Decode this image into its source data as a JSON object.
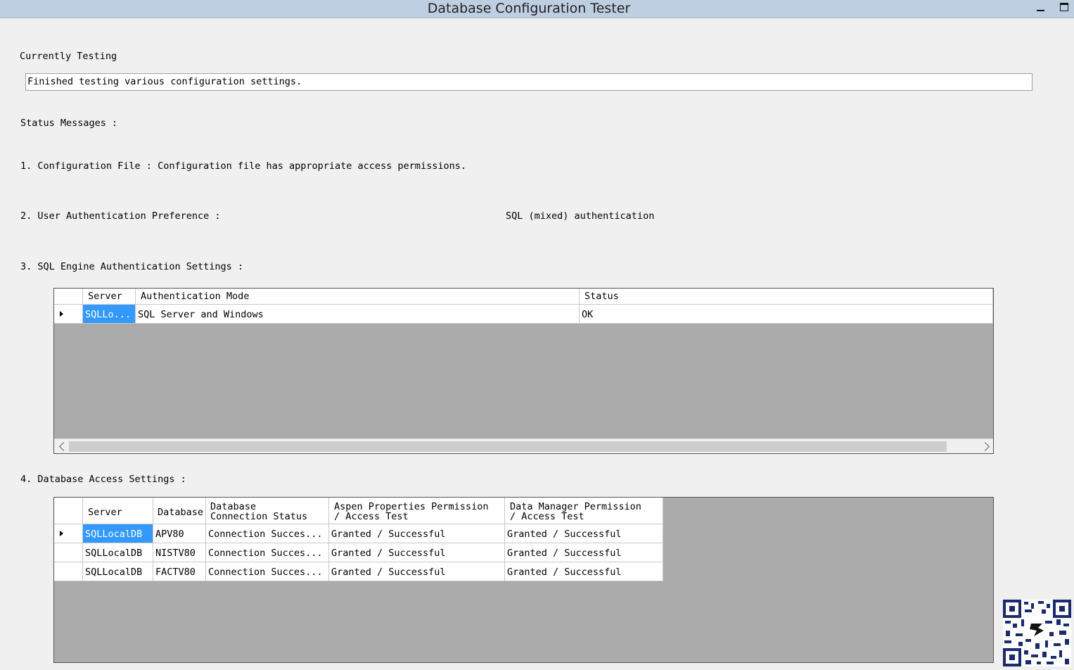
{
  "window": {
    "title": "Database Configuration Tester",
    "minimize_icon": "minimize-icon",
    "maximize_icon": "maximize-icon"
  },
  "currently_testing": {
    "label": "Currently Testing",
    "value": "Finished testing various configuration settings."
  },
  "status_messages": {
    "label": "Status Messages :",
    "item1": "1. Configuration File : Configuration file has appropriate access permissions.",
    "item2_label": "2. User Authentication Preference :",
    "item2_value": "SQL (mixed) authentication",
    "item3_label": "3. SQL Engine Authentication Settings :",
    "item4_label": "4. Database Access Settings :"
  },
  "engine_grid": {
    "columns": [
      "Server",
      "Authentication Mode",
      "Status"
    ],
    "rows": [
      {
        "server": "SQLLo...",
        "auth_mode": "SQL Server and Windows",
        "status": "OK"
      }
    ]
  },
  "access_grid": {
    "columns": {
      "server": "Server",
      "database": "Database",
      "conn": "Database\nConnection Status",
      "aspen": "Aspen Properties Permission\n/ Access Test",
      "dm": "Data Manager Permission\n/ Access Test"
    },
    "rows": [
      {
        "server": "SQLLocalDB",
        "database": "APV80",
        "conn": "Connection Succes...",
        "aspen": "Granted / Successful",
        "dm": "Granted / Successful"
      },
      {
        "server": "SQLLocalDB",
        "database": "NISTV80",
        "conn": "Connection Succes...",
        "aspen": "Granted / Successful",
        "dm": "Granted / Successful"
      },
      {
        "server": "SQLLocalDB",
        "database": "FACTV80",
        "conn": "Connection Succes...",
        "aspen": "Granted / Successful",
        "dm": "Granted / Successful"
      }
    ]
  },
  "colors": {
    "titlebar": "#bfcfe2",
    "grid_background": "#ababab",
    "selection": "#3399ff"
  },
  "qr_icon": "qr-code-icon"
}
